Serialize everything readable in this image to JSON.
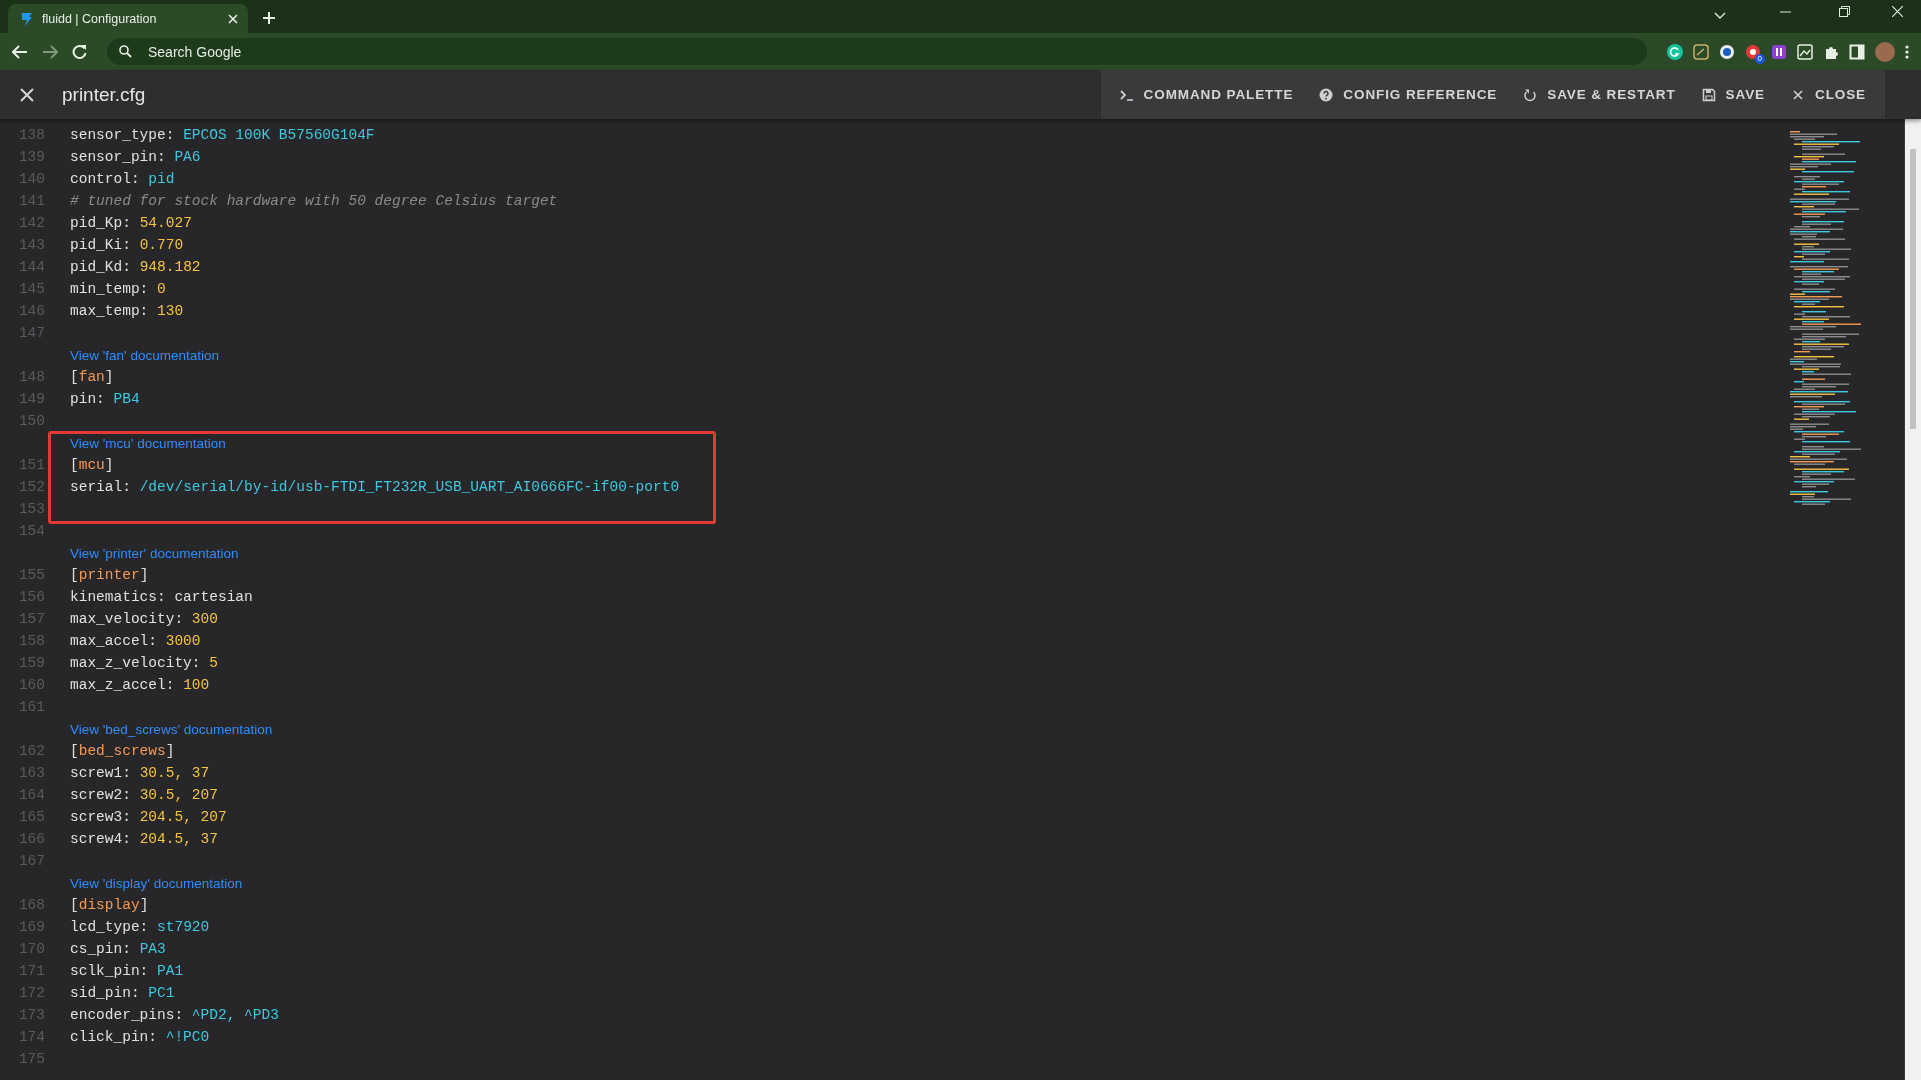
{
  "browser": {
    "tab": {
      "title": "fluidd | Configuration",
      "selected": true
    },
    "address": {
      "placeholder": "Search Google"
    },
    "extension_badge": "0"
  },
  "header": {
    "title": "printer.cfg",
    "actions": [
      {
        "label": "COMMAND PALETTE",
        "kind": "terminal"
      },
      {
        "label": "CONFIG REFERENCE",
        "kind": "help"
      },
      {
        "label": "SAVE & RESTART",
        "kind": "restart"
      },
      {
        "label": "SAVE",
        "kind": "save"
      },
      {
        "label": "CLOSE",
        "kind": "close"
      }
    ]
  },
  "editor": {
    "lines": [
      {
        "kind": "pair",
        "number": "138",
        "key": "sensor_type:",
        "value": {
          "text": "EPCOS 100K B57560G104F",
          "kind": "string"
        },
        "highlighted": false
      },
      {
        "kind": "pair",
        "number": "139",
        "key": "sensor_pin:",
        "value": {
          "text": "PA6",
          "kind": "string"
        },
        "highlighted": false
      },
      {
        "kind": "pair",
        "number": "140",
        "key": "control:",
        "value": {
          "text": "pid",
          "kind": "string"
        },
        "highlighted": false
      },
      {
        "kind": "comment",
        "number": "141",
        "text": "# tuned for stock hardware with 50 degree Celsius target",
        "highlighted": false
      },
      {
        "kind": "pair",
        "number": "142",
        "key": "pid_Kp:",
        "value": {
          "text": "54.027",
          "kind": "number"
        },
        "highlighted": false
      },
      {
        "kind": "pair",
        "number": "143",
        "key": "pid_Ki:",
        "value": {
          "text": "0.770",
          "kind": "number"
        },
        "highlighted": false
      },
      {
        "kind": "pair",
        "number": "144",
        "key": "pid_Kd:",
        "value": {
          "text": "948.182",
          "kind": "number"
        },
        "highlighted": false
      },
      {
        "kind": "pair",
        "number": "145",
        "key": "min_temp:",
        "value": {
          "text": "0",
          "kind": "number"
        },
        "highlighted": false
      },
      {
        "kind": "pair",
        "number": "146",
        "key": "max_temp:",
        "value": {
          "text": "130",
          "kind": "number"
        },
        "highlighted": false
      },
      {
        "kind": "blank",
        "number": "147",
        "highlighted": false
      },
      {
        "kind": "doc",
        "text": "View 'fan' documentation",
        "highlighted": false
      },
      {
        "kind": "section",
        "number": "148",
        "text": "[fan]",
        "highlighted": false
      },
      {
        "kind": "pair",
        "number": "149",
        "key": "pin:",
        "value": {
          "text": "PB4",
          "kind": "string"
        },
        "highlighted": false
      },
      {
        "kind": "blank",
        "number": "150",
        "highlighted": false
      },
      {
        "kind": "doc",
        "text": "View 'mcu' documentation",
        "highlighted": true
      },
      {
        "kind": "section",
        "number": "151",
        "text": "[mcu]",
        "highlighted": true
      },
      {
        "kind": "pair",
        "number": "152",
        "key": "serial:",
        "value": {
          "text": "/dev/serial/by-id/usb-FTDI_FT232R_USB_UART_AI0666FC-if00-port0",
          "kind": "string"
        },
        "highlighted": true
      },
      {
        "kind": "blank",
        "number": "153",
        "highlighted": true
      },
      {
        "kind": "blank",
        "number": "154",
        "highlighted": false
      },
      {
        "kind": "doc",
        "text": "View 'printer' documentation",
        "highlighted": false
      },
      {
        "kind": "section",
        "number": "155",
        "text": "[printer]",
        "highlighted": false
      },
      {
        "kind": "pair",
        "number": "156",
        "key": "kinematics:",
        "value": {
          "text": "cartesian",
          "kind": "plain"
        },
        "highlighted": false
      },
      {
        "kind": "pair",
        "number": "157",
        "key": "max_velocity:",
        "value": {
          "text": "300",
          "kind": "number"
        },
        "highlighted": false
      },
      {
        "kind": "pair",
        "number": "158",
        "key": "max_accel:",
        "value": {
          "text": "3000",
          "kind": "number"
        },
        "highlighted": false
      },
      {
        "kind": "pair",
        "number": "159",
        "key": "max_z_velocity:",
        "value": {
          "text": "5",
          "kind": "number"
        },
        "highlighted": false
      },
      {
        "kind": "pair",
        "number": "160",
        "key": "max_z_accel:",
        "value": {
          "text": "100",
          "kind": "number"
        },
        "highlighted": false
      },
      {
        "kind": "blank",
        "number": "161",
        "highlighted": false
      },
      {
        "kind": "doc",
        "text": "View 'bed_screws' documentation",
        "highlighted": false
      },
      {
        "kind": "section",
        "number": "162",
        "text": "[bed_screws]",
        "highlighted": false
      },
      {
        "kind": "pair",
        "number": "163",
        "key": "screw1:",
        "value": {
          "text": "30.5, 37",
          "kind": "number"
        },
        "highlighted": false
      },
      {
        "kind": "pair",
        "number": "164",
        "key": "screw2:",
        "value": {
          "text": "30.5, 207",
          "kind": "number"
        },
        "highlighted": false
      },
      {
        "kind": "pair",
        "number": "165",
        "key": "screw3:",
        "value": {
          "text": "204.5, 207",
          "kind": "number"
        },
        "highlighted": false
      },
      {
        "kind": "pair",
        "number": "166",
        "key": "screw4:",
        "value": {
          "text": "204.5, 37",
          "kind": "number"
        },
        "highlighted": false
      },
      {
        "kind": "blank",
        "number": "167",
        "highlighted": false
      },
      {
        "kind": "doc",
        "text": "View 'display' documentation",
        "highlighted": false
      },
      {
        "kind": "section",
        "number": "168",
        "text": "[display]",
        "highlighted": false
      },
      {
        "kind": "pair",
        "number": "169",
        "key": "lcd_type:",
        "value": {
          "text": "st7920",
          "kind": "string"
        },
        "highlighted": false
      },
      {
        "kind": "pair",
        "number": "170",
        "key": "cs_pin:",
        "value": {
          "text": "PA3",
          "kind": "string"
        },
        "highlighted": false
      },
      {
        "kind": "pair",
        "number": "171",
        "key": "sclk_pin:",
        "value": {
          "text": "PA1",
          "kind": "string"
        },
        "highlighted": false
      },
      {
        "kind": "pair",
        "number": "172",
        "key": "sid_pin:",
        "value": {
          "text": "PC1",
          "kind": "string"
        },
        "highlighted": false
      },
      {
        "kind": "pair",
        "number": "173",
        "key": "encoder_pins:",
        "value": {
          "text": "^PD2, ^PD3",
          "kind": "string"
        },
        "highlighted": false
      },
      {
        "kind": "pair",
        "number": "174",
        "key": "click_pin:",
        "value": {
          "text": "^!PC0",
          "kind": "string"
        },
        "highlighted": false
      },
      {
        "kind": "blank",
        "number": "175",
        "highlighted": false
      }
    ]
  }
}
